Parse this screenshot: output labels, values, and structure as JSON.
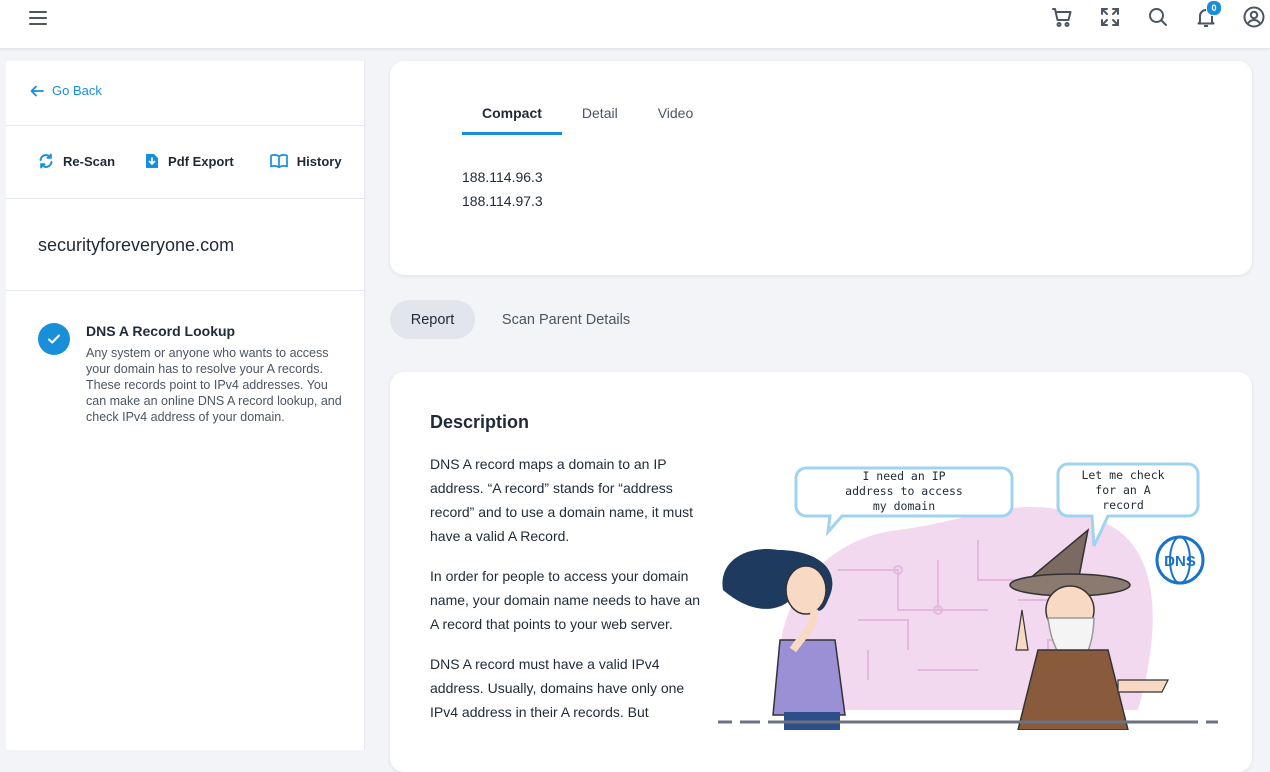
{
  "header": {
    "notification_count": "0",
    "icons": [
      "menu-icon",
      "cart-icon",
      "fullscreen-icon",
      "search-icon",
      "bell-icon",
      "account-icon"
    ]
  },
  "sidebar": {
    "back_label": "Go Back",
    "actions": [
      {
        "label": "Re-Scan",
        "icon": "refresh-icon"
      },
      {
        "label": "Pdf Export",
        "icon": "download-icon"
      },
      {
        "label": "History",
        "icon": "book-icon"
      }
    ],
    "domain": "securityforeveryone.com",
    "check": {
      "title": "DNS A Record Lookup",
      "description": "Any system or anyone who wants to access your domain has to resolve your A records. These records point to IPv4 addresses. You can make an online DNS A record lookup, and check IPv4 address of your domain."
    }
  },
  "result_card": {
    "tabs": [
      "Compact",
      "Detail",
      "Video"
    ],
    "active_tab": "Compact",
    "ips": [
      "188.114.96.3",
      "188.114.97.3"
    ]
  },
  "report_tabs": [
    "Report",
    "Scan Parent Details"
  ],
  "description": {
    "title": "Description",
    "paragraphs": [
      "DNS A record maps a domain to an IP address. “A record” stands for “address record” and to use a domain name, it must have a valid A Record.",
      "In order for people to access your domain name, your domain name needs to have an A record that points to your web server.",
      "DNS A record must have a valid IPv4 address. Usually, domains have only one IPv4 address in their A records. But"
    ],
    "illustration": {
      "bubble_left": [
        "I need an IP",
        "address to access",
        "my domain"
      ],
      "bubble_right": [
        "Let me check",
        "for an A",
        "record"
      ],
      "badge": "DNS"
    }
  },
  "colors": {
    "accent": "#1a8fd9",
    "text": "#1f2a37",
    "muted": "#4b5563",
    "bg": "#f2f4f7"
  }
}
